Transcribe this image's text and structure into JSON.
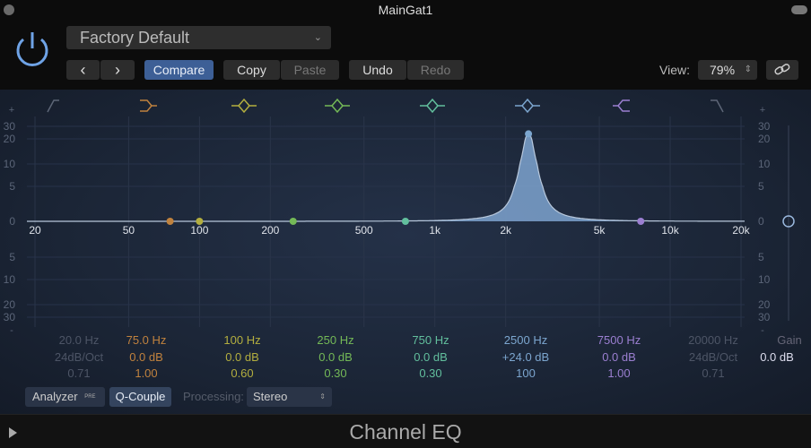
{
  "window": {
    "title": "MainGat1"
  },
  "header": {
    "preset": "Factory Default",
    "prev": "‹",
    "next": "›",
    "compare": "Compare",
    "copy": "Copy",
    "paste": "Paste",
    "undo": "Undo",
    "redo": "Redo",
    "view_label": "View:",
    "view_value": "79%",
    "link_icon": "link-icon"
  },
  "graph": {
    "freq_ticks": [
      "20",
      "50",
      "100",
      "200",
      "500",
      "1k",
      "2k",
      "5k",
      "10k",
      "20k"
    ],
    "db_ticks_top": [
      "30",
      "20",
      "10",
      "5",
      "0"
    ],
    "db_ticks_bottom": [
      "5",
      "10",
      "20",
      "30"
    ],
    "plus": "+",
    "minus": "-"
  },
  "bands": [
    {
      "type": "low-cut",
      "freq": "20.0 Hz",
      "gain": "24dB/Oct",
      "q": "0.71",
      "color": "#5d6677",
      "enabled": false
    },
    {
      "type": "low-shelf",
      "freq": "75.0 Hz",
      "gain": "0.0 dB",
      "q": "1.00",
      "color": "#c0823e",
      "hz": 75,
      "db": 0
    },
    {
      "type": "bell",
      "freq": "100 Hz",
      "gain": "0.0 dB",
      "q": "0.60",
      "color": "#b3ae3f",
      "hz": 100,
      "db": 0
    },
    {
      "type": "bell",
      "freq": "250 Hz",
      "gain": "0.0 dB",
      "q": "0.30",
      "color": "#74b957",
      "hz": 250,
      "db": 0
    },
    {
      "type": "bell",
      "freq": "750 Hz",
      "gain": "0.0 dB",
      "q": "0.30",
      "color": "#62bf9d",
      "hz": 750,
      "db": 0
    },
    {
      "type": "bell",
      "freq": "2500 Hz",
      "gain": "+24.0 dB",
      "q": "100",
      "color": "#7ca6cf",
      "hz": 2500,
      "db": 24
    },
    {
      "type": "high-shelf",
      "freq": "7500 Hz",
      "gain": "0.0 dB",
      "q": "1.00",
      "color": "#9b7fd1",
      "hz": 7500,
      "db": 0
    },
    {
      "type": "high-cut",
      "freq": "20000 Hz",
      "gain": "24dB/Oct",
      "q": "0.71",
      "color": "#5d6677",
      "enabled": false
    }
  ],
  "master": {
    "label": "Gain",
    "value": "0.0 dB"
  },
  "bottom": {
    "analyzer": "Analyzer",
    "pre": "PRE",
    "qcouple": "Q-Couple",
    "processing_label": "Processing:",
    "processing_value": "Stereo"
  },
  "footer": {
    "title": "Channel EQ"
  }
}
